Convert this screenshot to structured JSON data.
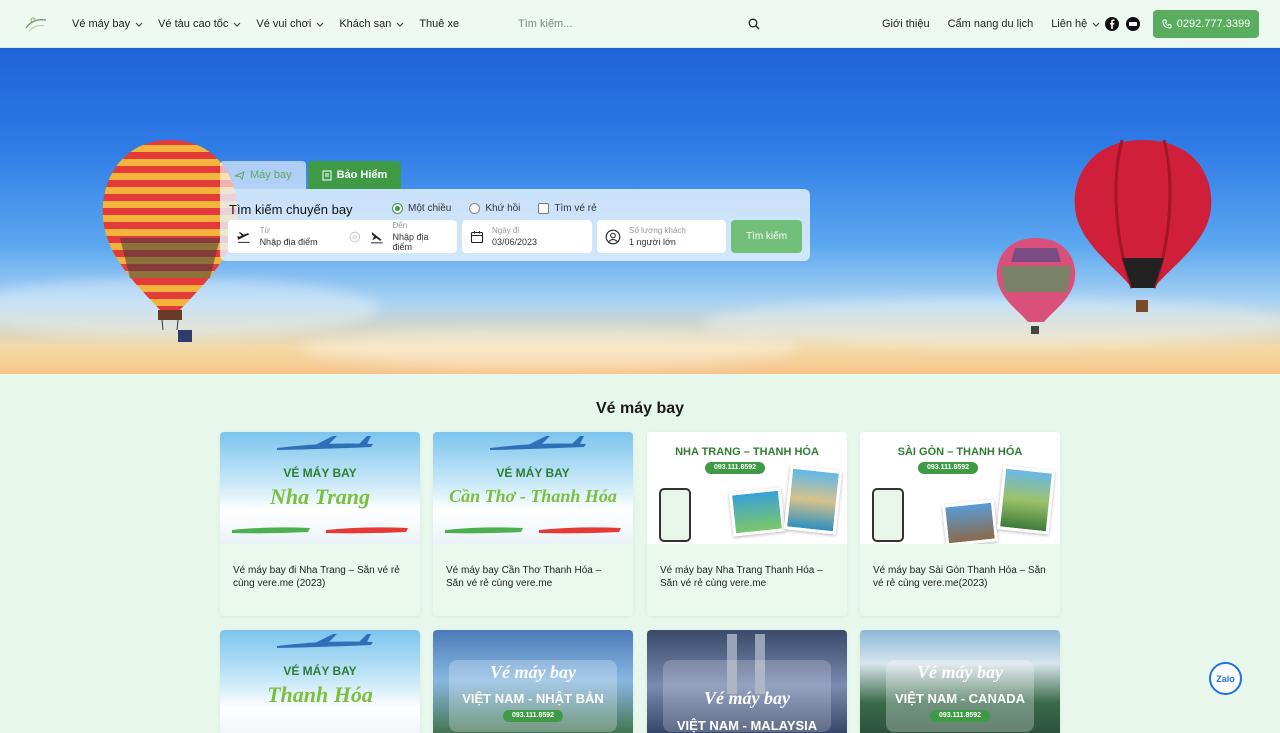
{
  "header": {
    "nav": [
      {
        "label": "Vé máy bay",
        "dropdown": true
      },
      {
        "label": "Vé tàu cao tốc",
        "dropdown": true
      },
      {
        "label": "Vé vui chơi",
        "dropdown": true
      },
      {
        "label": "Khách sạn",
        "dropdown": true
      },
      {
        "label": "Thuê xe",
        "dropdown": false
      }
    ],
    "search_placeholder": "Tìm kiếm...",
    "right_links": [
      {
        "label": "Giới thiệu"
      },
      {
        "label": "Cẩm nang du lịch"
      },
      {
        "label": "Liên hệ"
      }
    ],
    "phone": "0292.777.3399"
  },
  "search_widget": {
    "tabs": [
      {
        "label": "Máy bay"
      },
      {
        "label": "Bảo Hiểm"
      }
    ],
    "title": "Tìm kiếm chuyến bay",
    "trip_options": [
      {
        "label": "Một chiều",
        "selected": true
      },
      {
        "label": "Khứ hồi",
        "selected": false
      }
    ],
    "cheap_ticket_label": "Tìm vé rẻ",
    "from": {
      "label": "Từ",
      "placeholder": "Nhập địa điểm"
    },
    "to": {
      "label": "Đến",
      "placeholder": "Nhập địa điểm"
    },
    "date": {
      "label": "Ngày đi",
      "value": "03/06/2023"
    },
    "passengers": {
      "label": "Số lượng khách",
      "value": "1 người lớn"
    },
    "submit_label": "Tìm kiếm"
  },
  "section": {
    "title": "Vé máy bay"
  },
  "cards": [
    {
      "thumb_line1": "VÉ MÁY BAY",
      "thumb_line2": "Nha Trang",
      "caption": "Vé máy bay đi Nha Trang – Săn vé rẻ cùng vere.me (2023)"
    },
    {
      "thumb_line1": "VÉ MÁY BAY",
      "thumb_line2": "Cần Thơ - Thanh Hóa",
      "caption": "Vé máy bay Cần Thơ Thanh Hóa – Săn vé rẻ cùng vere.me"
    },
    {
      "thumb_line1": "NHA TRANG – THANH HÓA",
      "thumb_line2": "093.111.8592",
      "caption": "Vé máy bay Nha Trang Thanh Hóa – Săn vé rẻ cùng vere.me"
    },
    {
      "thumb_line1": "SÀI GÒN – THANH HÓA",
      "thumb_line2": "093.111.8592",
      "caption": "Vé máy bay Sài Gòn Thanh Hóa – Săn vé rẻ cùng vere.me(2023)"
    },
    {
      "thumb_line1": "VÉ MÁY BAY",
      "thumb_line2": "Thanh Hóa",
      "caption": ""
    },
    {
      "thumb_line1": "Vé máy bay",
      "thumb_line2": "VIỆT NAM - NHẬT BẢN",
      "thumb_line3": "093.111.8592",
      "caption": ""
    },
    {
      "thumb_line1": "Vé máy bay",
      "thumb_line2": "VIỆT NAM - MALAYSIA",
      "caption": ""
    },
    {
      "thumb_line1": "Vé máy bay",
      "thumb_line2": "VIỆT NAM - CANADA",
      "thumb_line3": "093.111.8592",
      "caption": ""
    }
  ],
  "zalo_label": "Zalo",
  "colors": {
    "accent": "#5aac5e",
    "accent_dark": "#3f9a45",
    "bg": "#e7f7ec"
  }
}
